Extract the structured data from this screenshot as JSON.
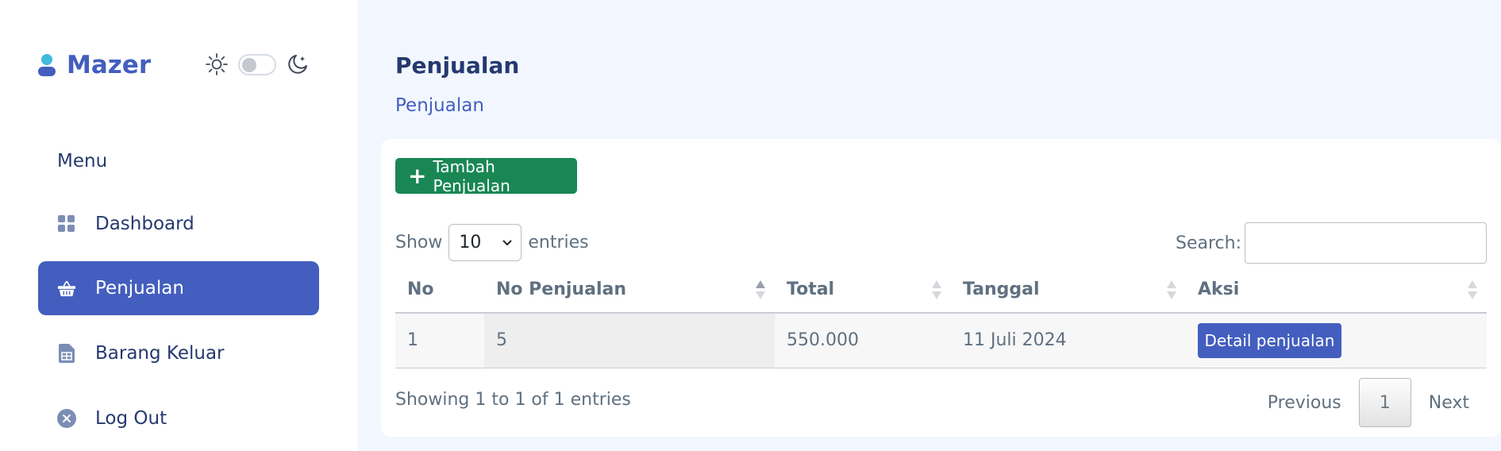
{
  "brand": {
    "name": "Mazer"
  },
  "sidebar": {
    "menu_title": "Menu",
    "items": [
      {
        "label": "Dashboard",
        "icon": "grid-icon",
        "active": false
      },
      {
        "label": "Penjualan",
        "icon": "basket-icon",
        "active": true
      },
      {
        "label": "Barang Keluar",
        "icon": "file-spreadsheet-icon",
        "active": false
      },
      {
        "label": "Log Out",
        "icon": "x-circle-icon",
        "active": false
      }
    ]
  },
  "header": {
    "title": "Penjualan",
    "breadcrumb": "Penjualan"
  },
  "toolbar": {
    "add_label": "Tambah Penjualan"
  },
  "table_controls": {
    "show_label": "Show",
    "entries_value": "10",
    "entries_label": "entries",
    "search_label": "Search:",
    "search_value": ""
  },
  "table": {
    "columns": [
      "No",
      "No Penjualan",
      "Total",
      "Tanggal",
      "Aksi"
    ],
    "rows": [
      {
        "no": "1",
        "no_penjualan": "5",
        "total": "550.000",
        "tanggal": "11 Juli 2024",
        "action": "Detail penjualan"
      }
    ]
  },
  "footer": {
    "info": "Showing 1 to 1 of 1 entries",
    "previous": "Previous",
    "current_page": "1",
    "next": "Next"
  },
  "colors": {
    "primary": "#435ebe",
    "success": "#198754",
    "background": "#f2f7ff",
    "text": "#25396f",
    "muted": "#607080"
  }
}
